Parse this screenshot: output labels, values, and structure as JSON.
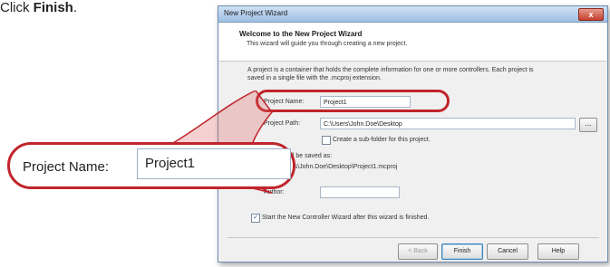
{
  "instruction": {
    "prefix": "Click ",
    "emph": "Finish",
    "suffix": "."
  },
  "window": {
    "title": "New Project Wizard",
    "close_glyph": "x"
  },
  "header": {
    "title": "Welcome to the New Project Wizard",
    "subtitle": "This wizard will guide you through creating a new project."
  },
  "intro": "A project is a container that holds the complete information for one or more controllers. Each project is saved in a single file with the .mcproj extension.",
  "fields": {
    "project_name_label": "Project Name:",
    "project_name_value": "Project1",
    "project_path_label": "Project Path:",
    "project_path_value": "C:\\Users\\John.Doe\\Desktop",
    "browse_label": "...",
    "subfolder_label": "Create a sub-folder for this project.",
    "saved_as_label": "Project will be saved as:",
    "saved_as_value": "C:\\Users\\John.Doe\\Desktop\\Project1.mcproj",
    "author_label": "Author:",
    "author_value": ""
  },
  "start_wizard_label": "Start the New Controller Wizard after this wizard is finished.",
  "buttons": {
    "back": "< Back",
    "finish": "Finish",
    "cancel": "Cancel",
    "help": "Help"
  },
  "zoom": {
    "label": "Project Name:",
    "value": "Project1"
  },
  "colors": {
    "highlight": "#c0252b",
    "titlebar": "#9fbfe4"
  }
}
